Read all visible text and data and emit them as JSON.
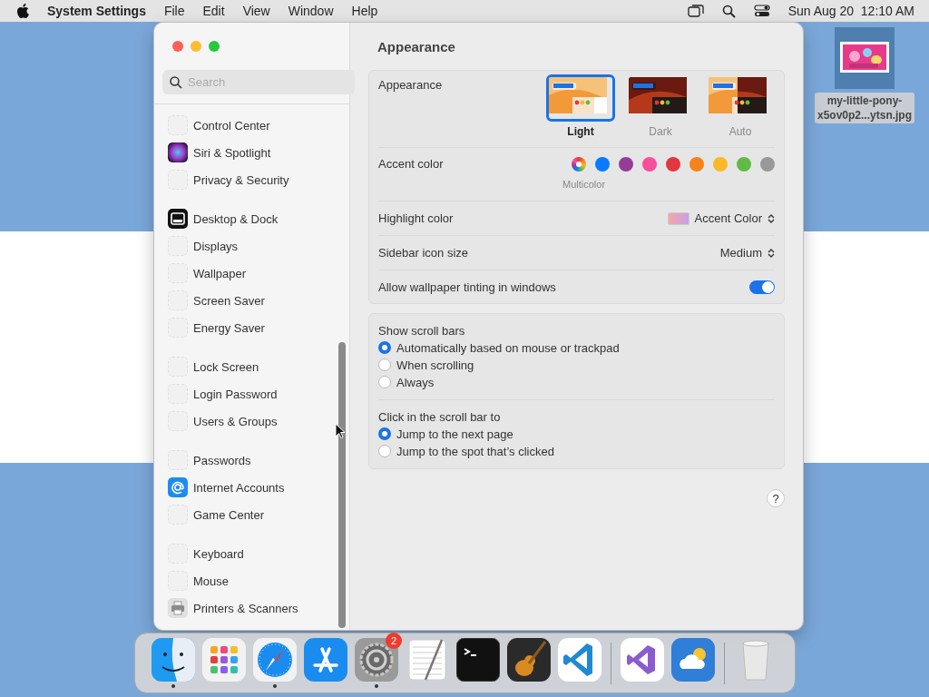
{
  "menubar": {
    "app_name": "System Settings",
    "menus": [
      "File",
      "Edit",
      "View",
      "Window",
      "Help"
    ],
    "clock": "Sun Aug 20  12:10 AM"
  },
  "desktop_file": {
    "name_lines": [
      "my-little-pony-",
      "x5ov0p2...ytsn.jpg"
    ]
  },
  "sidebar": {
    "search": {
      "placeholder": "Search"
    },
    "groups": [
      [
        {
          "label": "Control Center",
          "kind": "blank"
        },
        {
          "label": "Siri & Spotlight",
          "kind": "siri"
        },
        {
          "label": "Privacy & Security",
          "kind": "blank"
        }
      ],
      [
        {
          "label": "Desktop & Dock",
          "kind": "dock"
        },
        {
          "label": "Displays",
          "kind": "blank"
        },
        {
          "label": "Wallpaper",
          "kind": "blank"
        },
        {
          "label": "Screen Saver",
          "kind": "blank"
        },
        {
          "label": "Energy Saver",
          "kind": "blank"
        }
      ],
      [
        {
          "label": "Lock Screen",
          "kind": "blank"
        },
        {
          "label": "Login Password",
          "kind": "blank"
        },
        {
          "label": "Users & Groups",
          "kind": "blank"
        }
      ],
      [
        {
          "label": "Passwords",
          "kind": "blank"
        },
        {
          "label": "Internet Accounts",
          "kind": "at"
        },
        {
          "label": "Game Center",
          "kind": "blank"
        }
      ],
      [
        {
          "label": "Keyboard",
          "kind": "blank"
        },
        {
          "label": "Mouse",
          "kind": "blank"
        },
        {
          "label": "Printers & Scanners",
          "kind": "printer"
        }
      ]
    ]
  },
  "page_title": "Appearance",
  "appearance": {
    "label": "Appearance",
    "options": [
      {
        "label": "Light",
        "kind": "light",
        "selected": true
      },
      {
        "label": "Dark",
        "kind": "dark",
        "selected": false
      },
      {
        "label": "Auto",
        "kind": "auto",
        "selected": false
      }
    ]
  },
  "accent_color": {
    "label": "Accent color",
    "caption": "Multicolor",
    "colors": [
      {
        "kind": "multicolor",
        "selected": true
      },
      {
        "kind": "solid",
        "color": "#0a7aff",
        "selected": false
      },
      {
        "kind": "solid",
        "color": "#953d96",
        "selected": false
      },
      {
        "kind": "solid",
        "color": "#f74f9e",
        "selected": false
      },
      {
        "kind": "solid",
        "color": "#e0383e",
        "selected": false
      },
      {
        "kind": "solid",
        "color": "#f7821b",
        "selected": false
      },
      {
        "kind": "solid",
        "color": "#fcb827",
        "selected": false
      },
      {
        "kind": "solid",
        "color": "#62ba46",
        "selected": false
      },
      {
        "kind": "solid",
        "color": "#989898",
        "selected": false
      }
    ]
  },
  "highlight_color": {
    "label": "Highlight color",
    "value": "Accent Color"
  },
  "sidebar_icon_size": {
    "label": "Sidebar icon size",
    "value": "Medium"
  },
  "wallpaper_tinting": {
    "label": "Allow wallpaper tinting in windows",
    "on": true
  },
  "show_scroll_bars": {
    "label": "Show scroll bars",
    "options": [
      {
        "label": "Automatically based on mouse or trackpad",
        "selected": true
      },
      {
        "label": "When scrolling",
        "selected": false
      },
      {
        "label": "Always",
        "selected": false
      }
    ]
  },
  "click_scroll_bar": {
    "label": "Click in the scroll bar to",
    "options": [
      {
        "label": "Jump to the next page",
        "selected": true
      },
      {
        "label": "Jump to the spot that’s clicked",
        "selected": false
      }
    ]
  },
  "help": "?",
  "dock": {
    "groups": [
      [
        {
          "kind": "finder",
          "running": true
        },
        {
          "kind": "launchpad",
          "running": false
        },
        {
          "kind": "safari",
          "running": true
        },
        {
          "kind": "appstore",
          "running": false
        },
        {
          "kind": "settings",
          "running": true,
          "badge": "2"
        },
        {
          "kind": "textedit",
          "running": false
        },
        {
          "kind": "terminal",
          "running": false
        },
        {
          "kind": "garageband",
          "running": false
        },
        {
          "kind": "vscode",
          "running": false
        }
      ],
      [
        {
          "kind": "visualstudio",
          "running": false
        },
        {
          "kind": "weather",
          "running": false
        }
      ],
      [
        {
          "kind": "trash",
          "running": false
        }
      ]
    ]
  }
}
